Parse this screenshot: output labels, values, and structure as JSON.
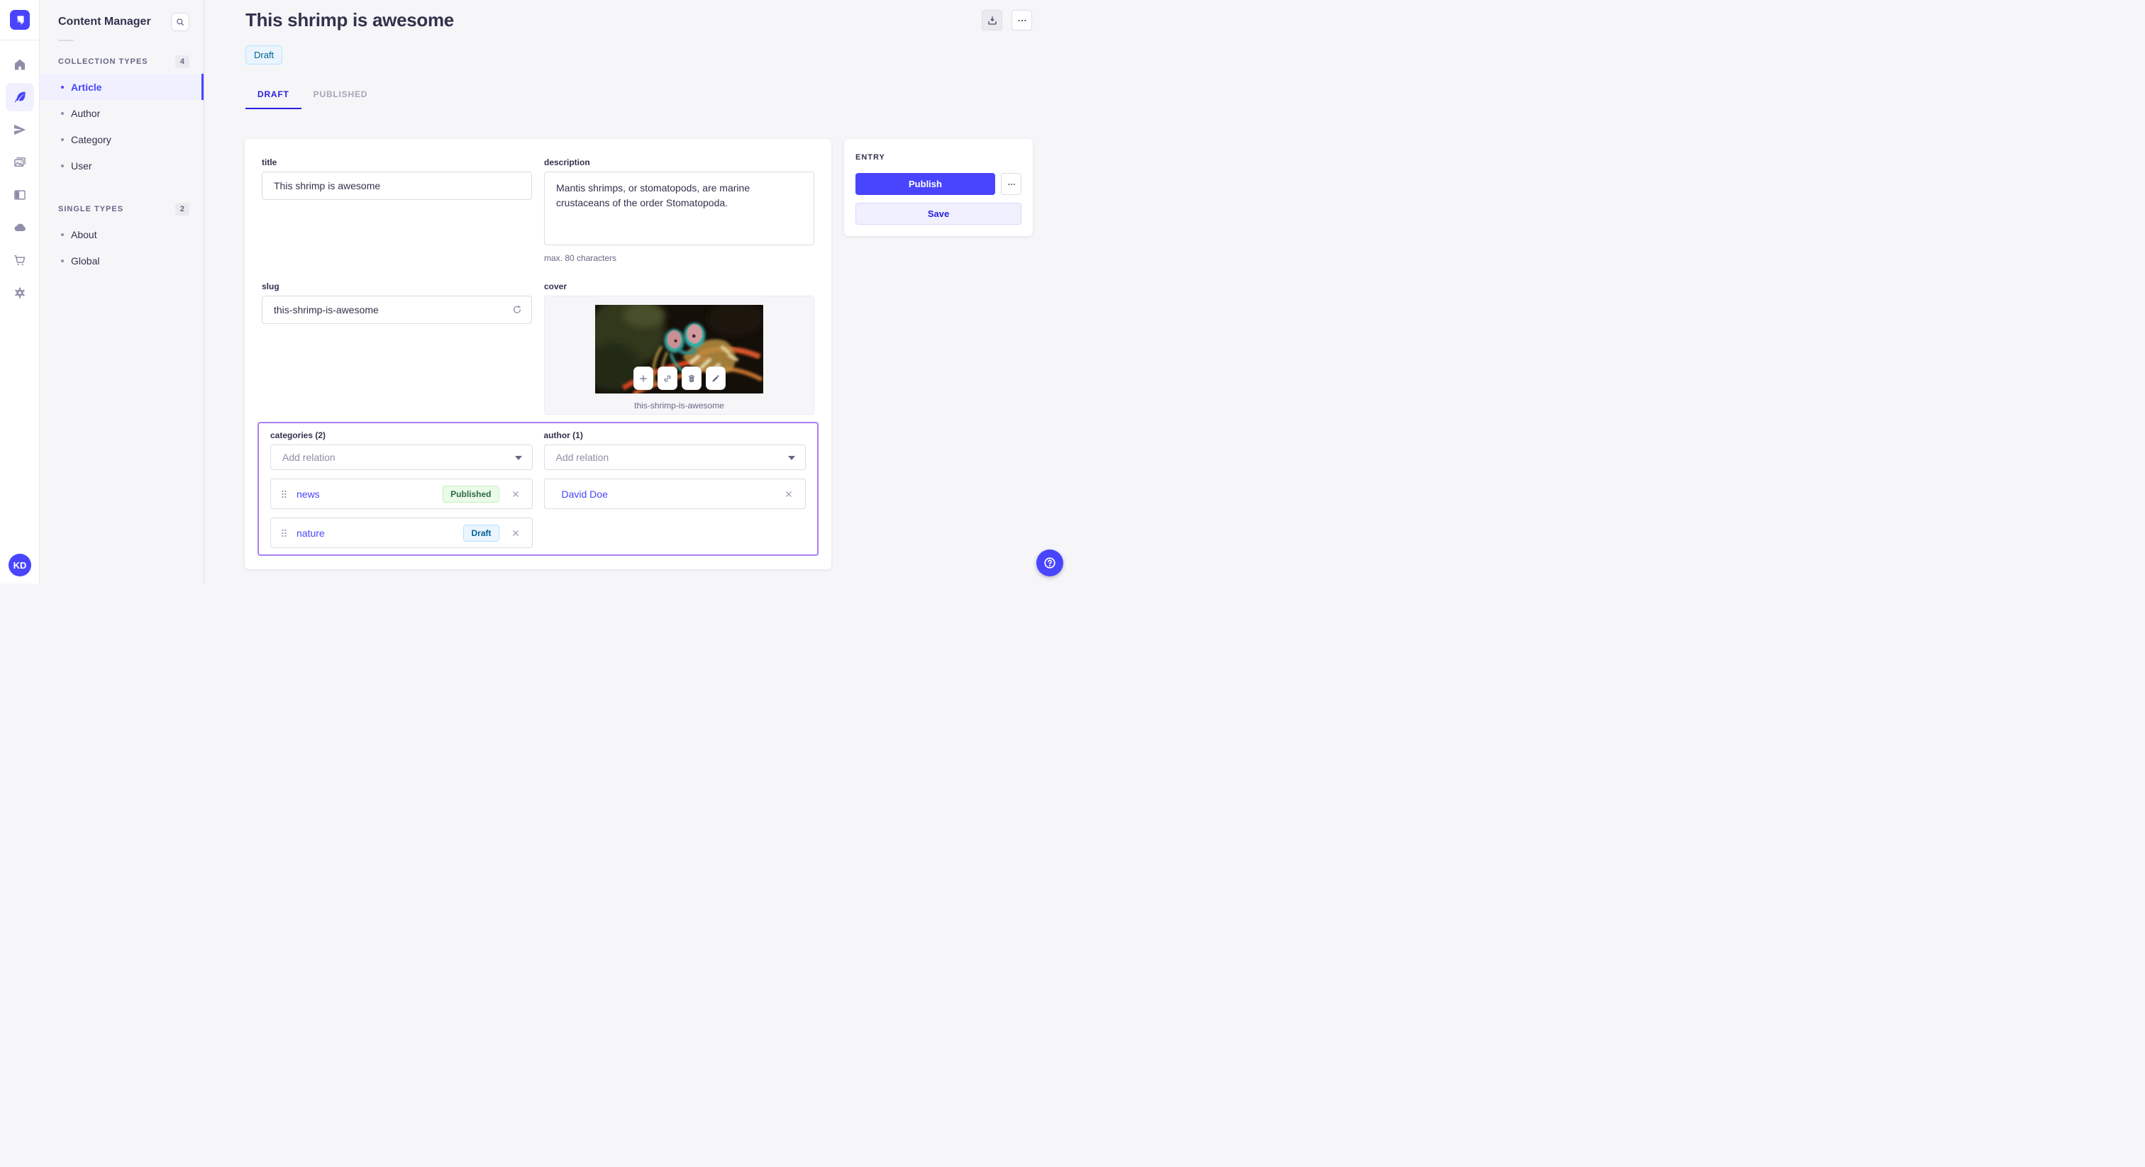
{
  "colors": {
    "accent": "#4945ff",
    "accent_dark": "#271fe0",
    "relations_highlight": "#a87ff2",
    "published_badge_text": "#2f6846",
    "draft_badge_text": "#006096"
  },
  "rail": {
    "logo_icon": "strapi-logo",
    "items": [
      {
        "icon": "home-icon",
        "active": false
      },
      {
        "icon": "feather-icon",
        "active": true
      },
      {
        "icon": "paper-plane-icon",
        "active": false
      },
      {
        "icon": "images-icon",
        "active": false
      },
      {
        "icon": "layout-icon",
        "active": false
      },
      {
        "icon": "cloud-icon",
        "active": false
      },
      {
        "icon": "cart-icon",
        "active": false
      },
      {
        "icon": "gear-icon",
        "active": false
      }
    ],
    "avatar_initials": "KD"
  },
  "subnav": {
    "title": "Content Manager",
    "search_icon": "search-icon",
    "sections": [
      {
        "heading": "COLLECTION TYPES",
        "count": "4",
        "items": [
          {
            "label": "Article",
            "active": true
          },
          {
            "label": "Author",
            "active": false
          },
          {
            "label": "Category",
            "active": false
          },
          {
            "label": "User",
            "active": false
          }
        ]
      },
      {
        "heading": "SINGLE TYPES",
        "count": "2",
        "items": [
          {
            "label": "About",
            "active": false
          },
          {
            "label": "Global",
            "active": false
          }
        ]
      }
    ]
  },
  "header": {
    "title": "This shrimp is awesome",
    "status_badge": "Draft",
    "tabs": [
      {
        "label": "DRAFT",
        "active": true
      },
      {
        "label": "PUBLISHED",
        "active": false
      }
    ]
  },
  "form": {
    "title_field": {
      "label": "title",
      "value": "This shrimp is awesome"
    },
    "description_field": {
      "label": "description",
      "value": "Mantis shrimps, or stomatopods, are marine crustaceans of the order Stomatopoda.",
      "hint": "max. 80 characters"
    },
    "slug_field": {
      "label": "slug",
      "value": "this-shrimp-is-awesome"
    },
    "cover_field": {
      "label": "cover",
      "caption": "this-shrimp-is-awesome"
    },
    "categories_field": {
      "label": "categories (2)",
      "placeholder": "Add relation",
      "relations": [
        {
          "name": "news",
          "status": "Published"
        },
        {
          "name": "nature",
          "status": "Draft"
        }
      ]
    },
    "author_field": {
      "label": "author (1)",
      "placeholder": "Add relation",
      "relations": [
        {
          "name": "David Doe"
        }
      ]
    }
  },
  "entry_panel": {
    "heading": "ENTRY",
    "publish_label": "Publish",
    "save_label": "Save"
  }
}
